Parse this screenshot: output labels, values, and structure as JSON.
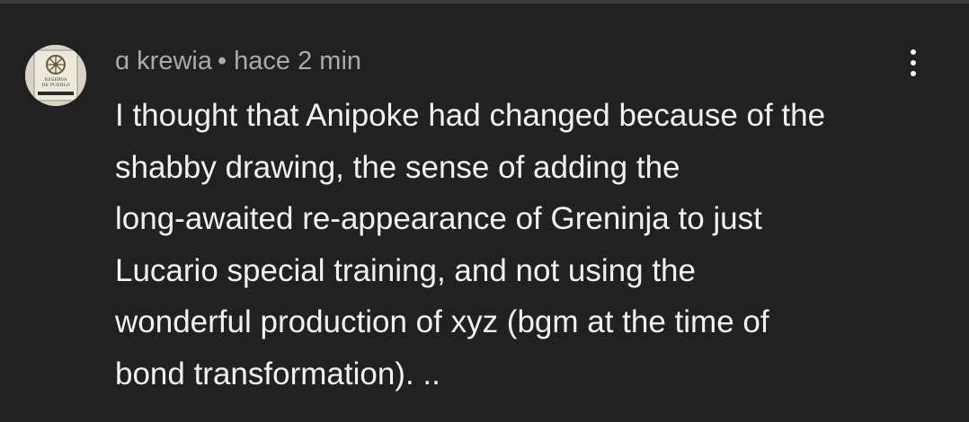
{
  "comment": {
    "author": "ɑ krewia",
    "separator": "•",
    "time": "hace 2 min",
    "avatar_icon": "wine-label-avatar",
    "avatar_text": [
      "RESERVA",
      "DE PUEBLO"
    ],
    "more_icon": "more-vertical-icon",
    "text_lines": [
      "I thought that Anipoke had changed because of the",
      "shabby drawing, the sense of adding the",
      "long-awaited re-appearance of Greninja to just",
      "Lucario special training, and not using the",
      "wonderful production of xyz (bgm at the time of",
      "bond transformation). .."
    ]
  },
  "colors": {
    "background": "#212121",
    "meta_text": "#aaaaaa",
    "body_text": "#f1f1f1"
  }
}
